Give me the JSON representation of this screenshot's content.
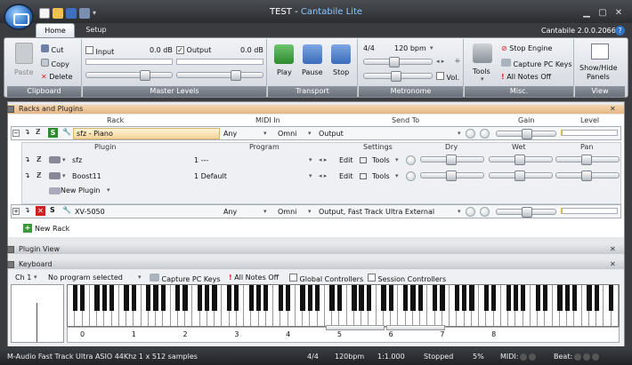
{
  "window": {
    "title_doc": "TEST",
    "title_sep": "-",
    "title_app": "Cantabile Lite",
    "version": "Cantabile 2.0.0.2066"
  },
  "tabs": [
    {
      "label": "Home"
    },
    {
      "label": "Setup"
    }
  ],
  "clipboard": {
    "paste": "Paste",
    "cut": "Cut",
    "copy": "Copy",
    "delete": "Delete",
    "label": "Clipboard"
  },
  "master_levels": {
    "input_label": "Input",
    "input_db": "0.0 dB",
    "output_label": "Output",
    "output_db": "0.0 dB",
    "label": "Master Levels"
  },
  "transport": {
    "play": "Play",
    "pause": "Pause",
    "stop": "Stop",
    "label": "Transport"
  },
  "metronome": {
    "time_sig": "4/4",
    "tempo": "120 bpm",
    "vol": "Vol.",
    "label": "Metronome"
  },
  "misc": {
    "tools": "Tools",
    "stop_engine": "Stop Engine",
    "capture_pc": "Capture PC Keys",
    "all_notes_off": "All Notes Off",
    "label": "Misc."
  },
  "view": {
    "show_hide_1": "Show/Hide",
    "show_hide_2": "Panels",
    "label": "View"
  },
  "racks_panel": {
    "title": "Racks and Plugins",
    "headers": {
      "rack": "Rack",
      "midi_in": "MIDI In",
      "send_to": "Send To",
      "gain": "Gain",
      "level": "Level"
    },
    "rack1": {
      "name": "sfz - Piano",
      "midi_in": "Any",
      "channel": "Omni",
      "send_to": "Output"
    },
    "plugin_headers": {
      "plugin": "Plugin",
      "program": "Program",
      "settings": "Settings",
      "dry": "Dry",
      "wet": "Wet",
      "pan": "Pan"
    },
    "plugins": [
      {
        "name": "sfz",
        "program": "1 ---",
        "edit": "Edit",
        "tools": "Tools"
      },
      {
        "name": "Boost11",
        "program": "1 Default",
        "edit": "Edit",
        "tools": "Tools"
      }
    ],
    "new_plugin": "New Plugin",
    "rack2": {
      "name": "XV-5050",
      "midi_in": "Any",
      "channel": "Omni",
      "send_to": "Output, Fast Track Ultra External"
    },
    "new_rack": "New Rack"
  },
  "plugin_view": {
    "title": "Plugin View"
  },
  "keyboard": {
    "title": "Keyboard",
    "channel": "Ch 1",
    "program": "No program selected",
    "capture_pc": "Capture PC Keys",
    "all_notes_off": "All Notes Off",
    "global_controllers": "Global Controllers",
    "session_controllers": "Session Controllers",
    "octaves": [
      "0",
      "1",
      "2",
      "3",
      "4",
      "5",
      "6",
      "7",
      "8"
    ]
  },
  "status": {
    "device": "M-Audio Fast Track Ultra ASIO 44Khz 1 x 512 samples",
    "time_sig": "4/4",
    "tempo": "120bpm",
    "position": "1:1.000",
    "state": "Stopped",
    "cpu": "5%",
    "midi": "MIDI:",
    "beat": "Beat:"
  },
  "colors": {
    "accent": "#e5b685",
    "ribbon_label": "#6a7079",
    "status_bg": "#202226"
  }
}
